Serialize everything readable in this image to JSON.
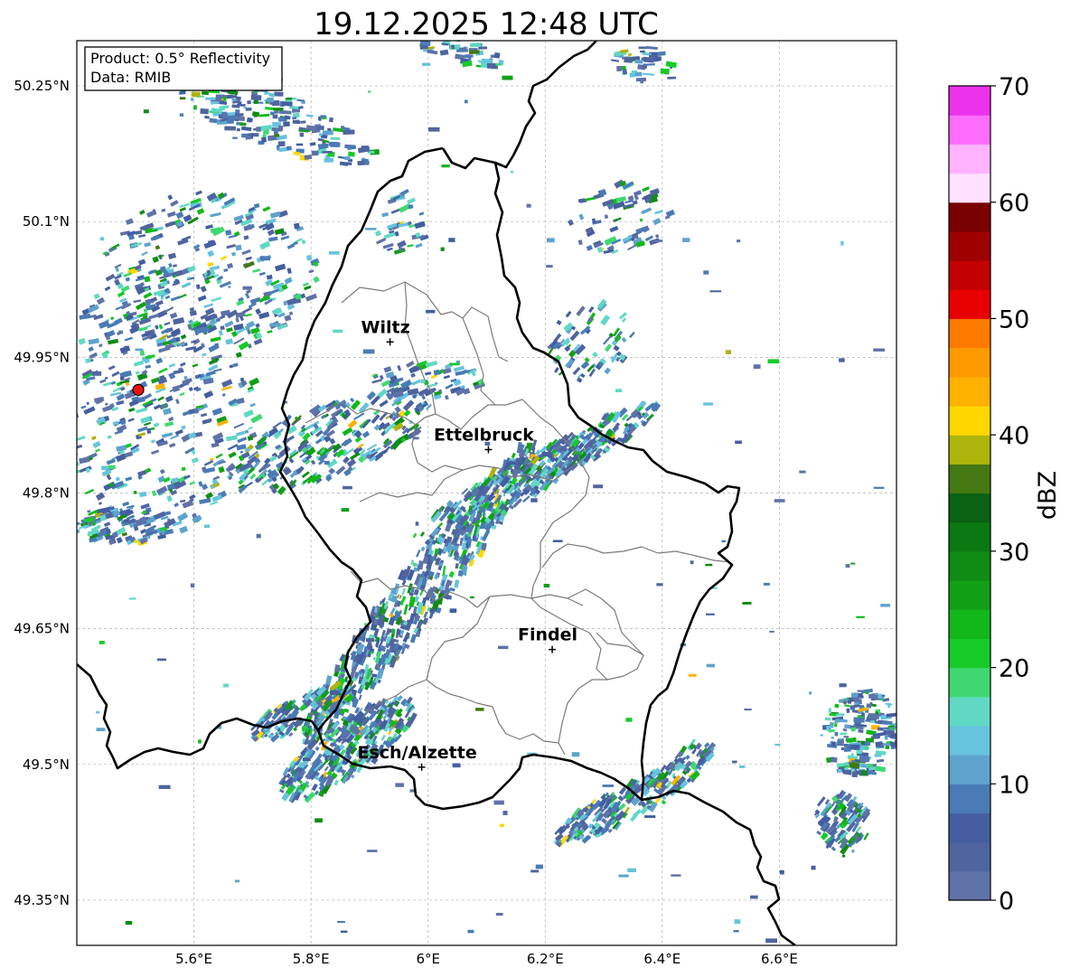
{
  "title": "19.12.2025 12:48 UTC",
  "info": {
    "product": "Product: 0.5° Reflectivity",
    "data_source": "Data: RMIB"
  },
  "map": {
    "lon_range": [
      5.4,
      6.8
    ],
    "lat_range": [
      49.3,
      50.3
    ],
    "x_ticks": [
      "5.6°E",
      "5.8°E",
      "6°E",
      "6.2°E",
      "6.4°E",
      "6.6°E"
    ],
    "y_ticks": [
      "50.25°N",
      "50.1°N",
      "49.95°N",
      "49.8°N",
      "49.65°N",
      "49.5°N",
      "49.35°N"
    ],
    "grid": true
  },
  "cities": [
    {
      "name": "Wiltz",
      "lon": 5.935,
      "lat": 49.967
    },
    {
      "name": "Ettelbruck",
      "lon": 6.103,
      "lat": 49.848
    },
    {
      "name": "Findel",
      "lon": 6.212,
      "lat": 49.627
    },
    {
      "name": "Esch/Alzette",
      "lon": 5.989,
      "lat": 49.497
    }
  ],
  "radar_site": {
    "lon": 5.505,
    "lat": 49.914,
    "color": "#ee1111"
  },
  "colorbar": {
    "label": "dBZ",
    "min": 0,
    "max": 70,
    "ticks": [
      "0",
      "10",
      "20",
      "30",
      "40",
      "50",
      "60",
      "70"
    ],
    "colors": [
      "#5f72a8",
      "#50659f",
      "#445ea0",
      "#4a7bb5",
      "#5ea3cd",
      "#66c3de",
      "#60d8c4",
      "#3fd870",
      "#16cb28",
      "#12b81a",
      "#119f16",
      "#0e8c13",
      "#0b7912",
      "#0a6212",
      "#447812",
      "#adb40c",
      "#ffd700",
      "#ffb100",
      "#ff9a00",
      "#ff7b00",
      "#e80000",
      "#c30000",
      "#9e0000",
      "#780000",
      "#ffe0ff",
      "#ffb3ff",
      "#ff6dff",
      "#ea33ea"
    ]
  }
}
